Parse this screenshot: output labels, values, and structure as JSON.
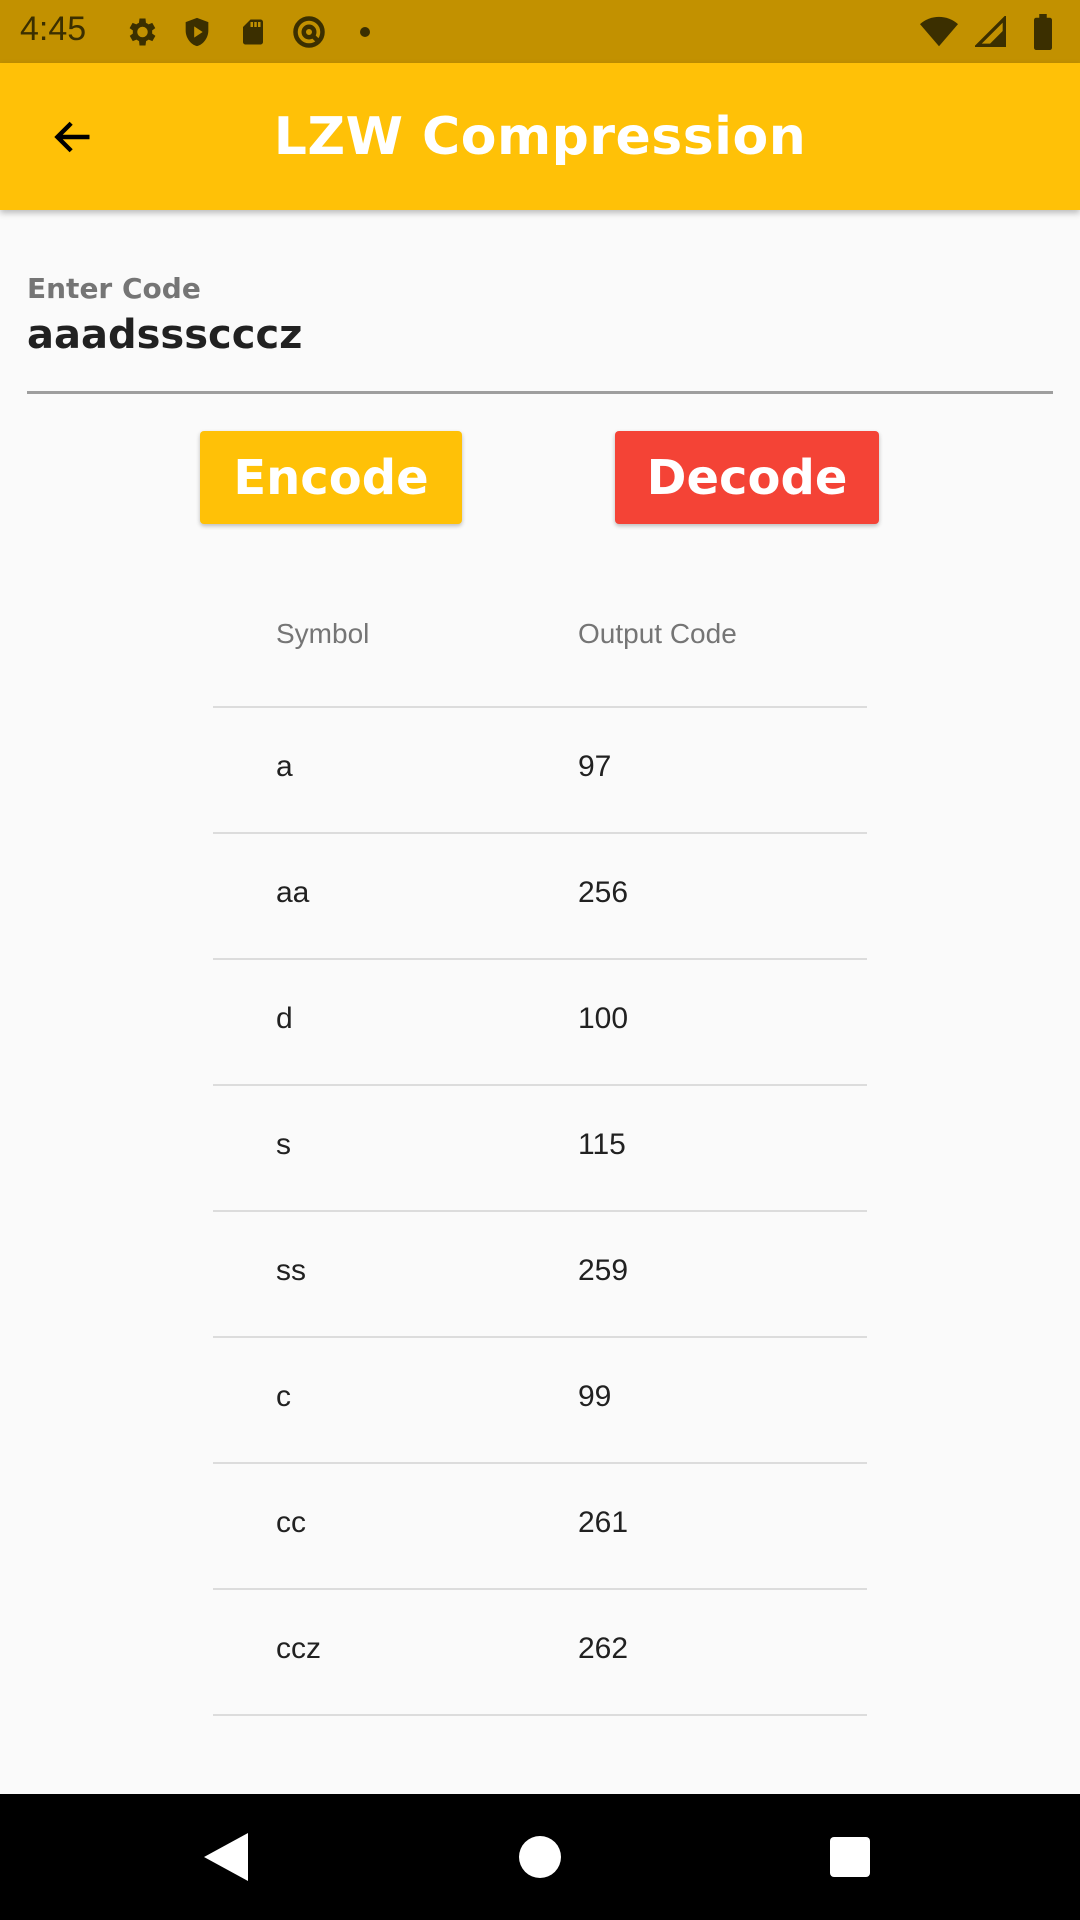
{
  "status_bar": {
    "time": "4:45",
    "left_icons": [
      "gear-icon",
      "shield-play-icon",
      "sd-card-icon",
      "at-sign-icon",
      "dot-icon"
    ],
    "right_icons": [
      "wifi-icon",
      "signal-icon",
      "battery-icon"
    ]
  },
  "app_bar": {
    "title": "LZW Compression",
    "background": "#ffc107"
  },
  "input": {
    "label": "Enter Code",
    "value": "aaadssscccz"
  },
  "buttons": {
    "encode": "Encode",
    "decode": "Decode",
    "encode_color": "#ffc107",
    "decode_color": "#f44336"
  },
  "table": {
    "headers": [
      "Symbol",
      "Output Code"
    ],
    "rows": [
      [
        "a",
        "97"
      ],
      [
        "aa",
        "256"
      ],
      [
        "d",
        "100"
      ],
      [
        "s",
        "115"
      ],
      [
        "ss",
        "259"
      ],
      [
        "c",
        "99"
      ],
      [
        "cc",
        "261"
      ],
      [
        "ccz",
        "262"
      ]
    ]
  },
  "nav_bar": {
    "buttons": [
      "back-triangle-icon",
      "home-circle-icon",
      "recents-square-icon"
    ]
  }
}
